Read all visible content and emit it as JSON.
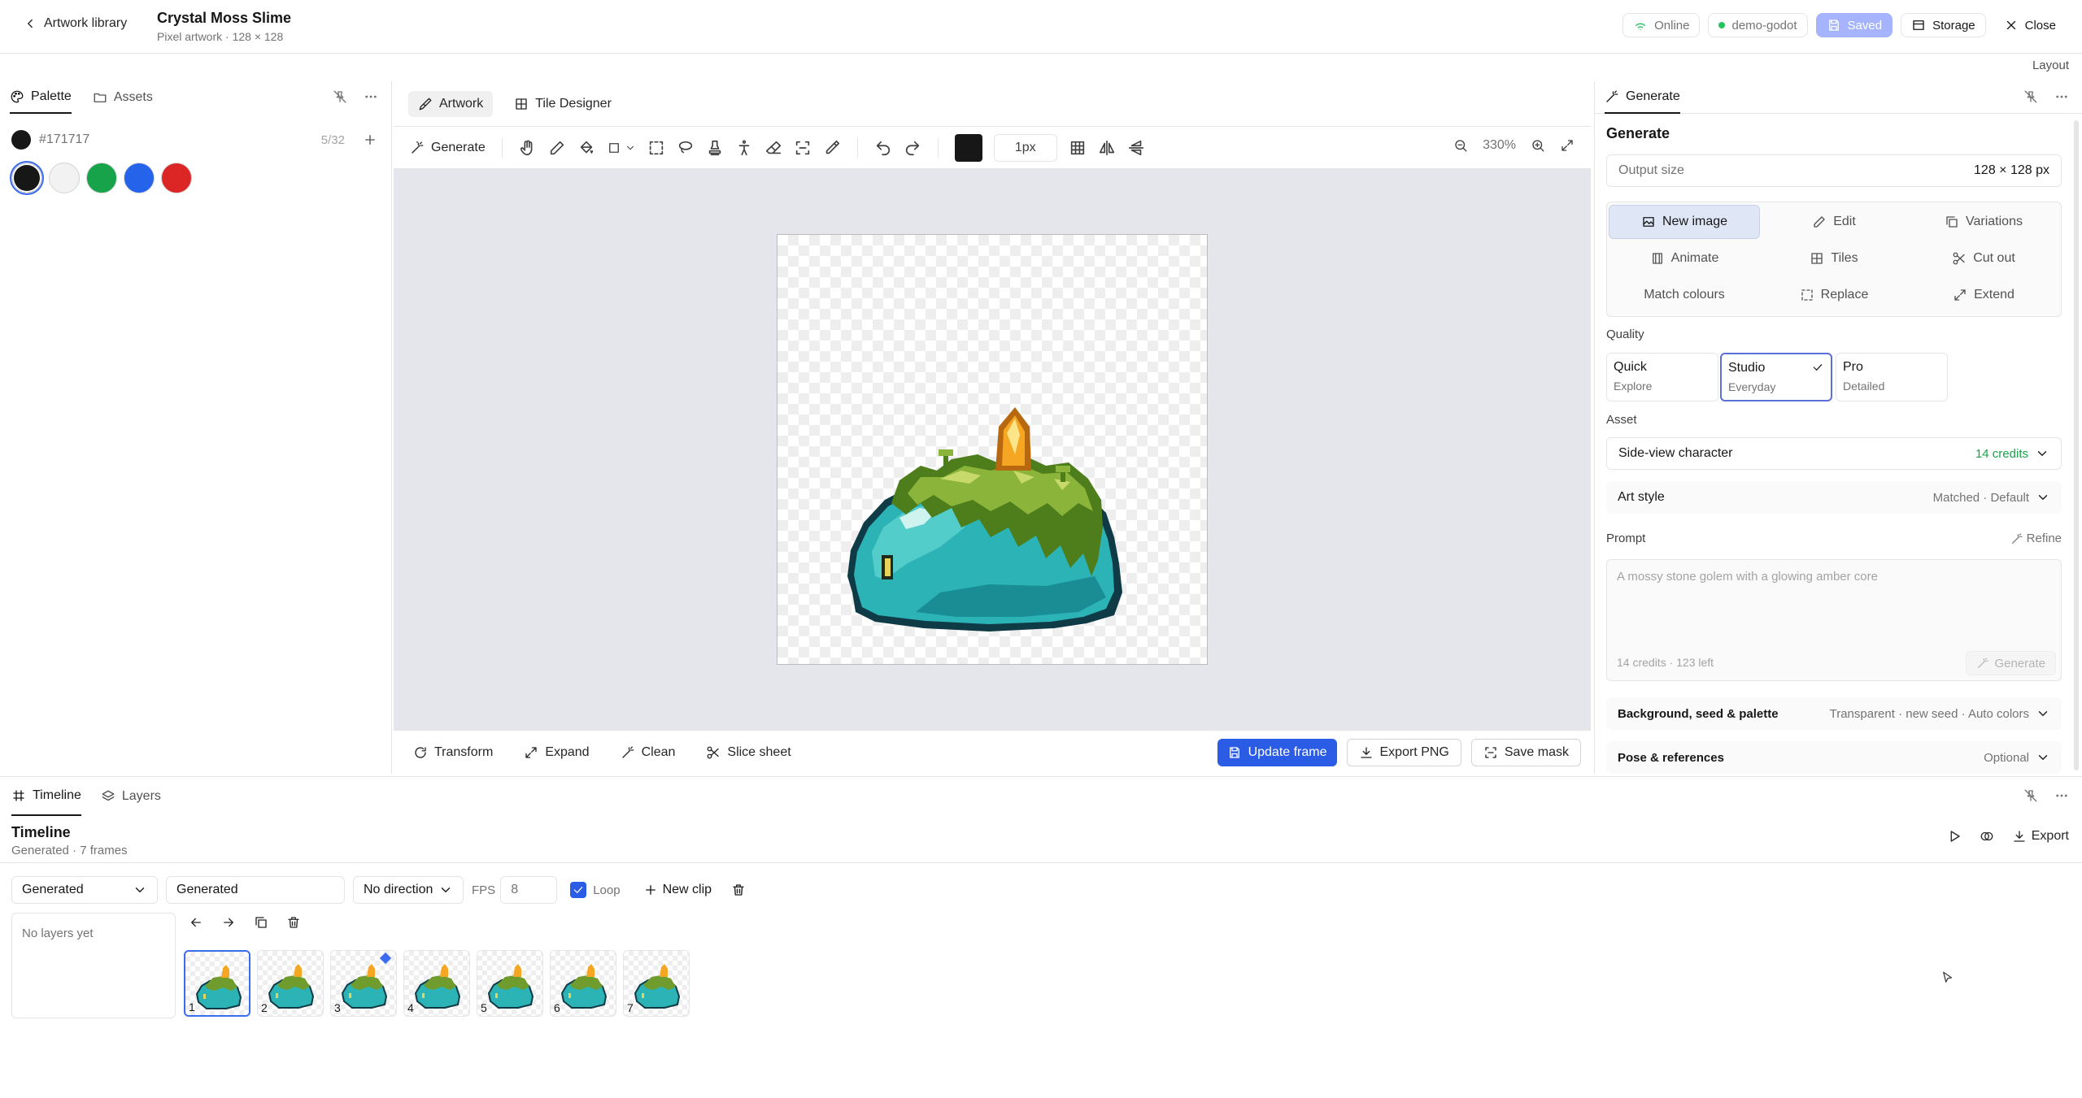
{
  "header": {
    "back_label": "Artwork library",
    "title": "Crystal Moss Slime",
    "subtitle": "Pixel artwork · 128 × 128",
    "status_online": "Online",
    "workspace": "demo-godot",
    "saved_label": "Saved",
    "storage_label": "Storage",
    "close_label": "Close",
    "layout_label": "Layout"
  },
  "left_panel": {
    "tabs": [
      "Palette",
      "Assets"
    ],
    "current_color": "#171717",
    "palette_count": "5/32",
    "swatches": [
      "#171717",
      "#f2f2f2",
      "#16a34a",
      "#2563eb",
      "#dc2626"
    ]
  },
  "center": {
    "tabs": [
      "Artwork",
      "Tile Designer"
    ],
    "generate_label": "Generate",
    "brush_size": "1px",
    "zoom": "330%",
    "bottom_actions": [
      "Transform",
      "Expand",
      "Clean",
      "Slice sheet"
    ],
    "update_frame": "Update frame",
    "export_png": "Export PNG",
    "save_mask": "Save mask"
  },
  "right_panel": {
    "tab_label": "Generate",
    "heading": "Generate",
    "output_size_label": "Output size",
    "output_size_value": "128 × 128 px",
    "modes": [
      "New image",
      "Edit",
      "Variations",
      "Animate",
      "Tiles",
      "Cut out",
      "Match colours",
      "Replace",
      "Extend"
    ],
    "quality_label": "Quality",
    "quality": [
      {
        "name": "Quick",
        "desc": "Explore"
      },
      {
        "name": "Studio",
        "desc": "Everyday"
      },
      {
        "name": "Pro",
        "desc": "Detailed"
      }
    ],
    "asset_label": "Asset",
    "asset_value": "Side-view character",
    "asset_credits": "14 credits",
    "art_style_label": "Art style",
    "art_style_value": "Matched · Default",
    "prompt_label": "Prompt",
    "refine_label": "Refine",
    "prompt_placeholder": "A mossy stone golem with a glowing amber core",
    "credits_info": "14 credits · 123 left",
    "generate_button": "Generate",
    "bg_label": "Background, seed & palette",
    "bg_value": "Transparent · new seed · Auto colors",
    "pose_label": "Pose & references",
    "pose_value": "Optional"
  },
  "timeline": {
    "tabs": [
      "Timeline",
      "Layers"
    ],
    "title": "Timeline",
    "subtitle": "Generated · 7 frames",
    "export_label": "Export",
    "clip_select": "Generated",
    "clip_name": "Generated",
    "direction": "No direction",
    "fps_label": "FPS",
    "fps_value": "8",
    "loop_label": "Loop",
    "new_clip_label": "New clip",
    "no_layers": "No layers yet",
    "frames": [
      "1",
      "2",
      "3",
      "4",
      "5",
      "6",
      "7"
    ]
  }
}
